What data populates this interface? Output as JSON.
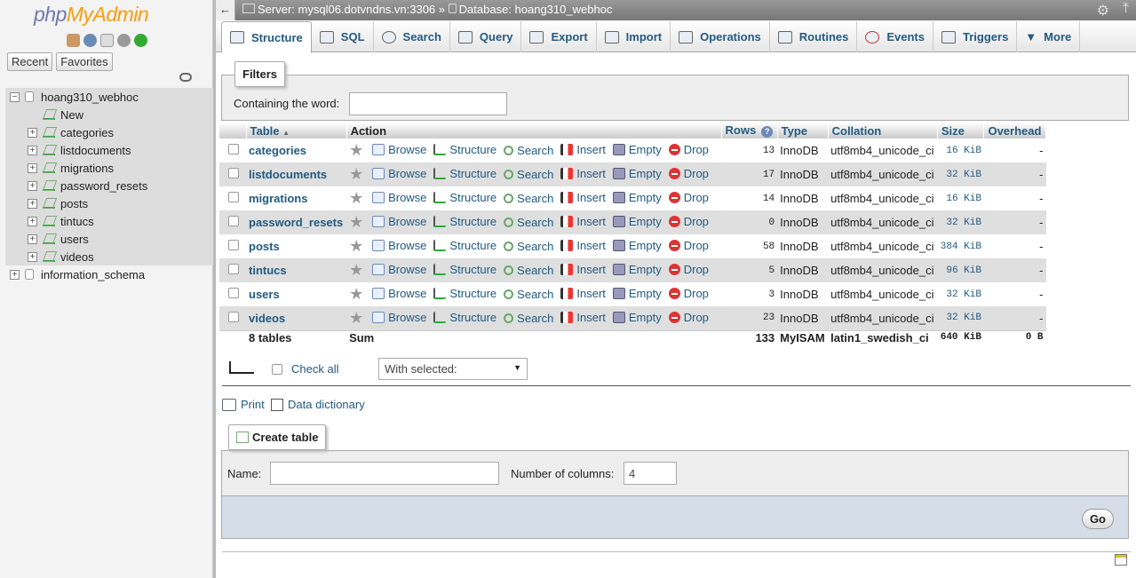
{
  "nav": {
    "logo_php": "php",
    "logo_myadmin": "MyAdmin",
    "icons": [
      "home-icon",
      "help-icon",
      "docs-icon",
      "settings-icon",
      "reload-icon"
    ],
    "recent_label": "Recent",
    "favorites_label": "Favorites",
    "tree": [
      {
        "label": "hoang310_webhoc",
        "kind": "db",
        "expanded": true
      },
      {
        "label": "New",
        "kind": "new"
      },
      {
        "label": "categories",
        "kind": "table"
      },
      {
        "label": "listdocuments",
        "kind": "table"
      },
      {
        "label": "migrations",
        "kind": "table"
      },
      {
        "label": "password_resets",
        "kind": "table"
      },
      {
        "label": "posts",
        "kind": "table"
      },
      {
        "label": "tintucs",
        "kind": "table"
      },
      {
        "label": "users",
        "kind": "table"
      },
      {
        "label": "videos",
        "kind": "table"
      },
      {
        "label": "information_schema",
        "kind": "db",
        "expanded": false
      }
    ]
  },
  "topbar": {
    "server": "Server: mysql06.dotvndns.vn:3306",
    "separator": "»",
    "database": "Database: hoang310_webhoc"
  },
  "tabs": [
    "Structure",
    "SQL",
    "Search",
    "Query",
    "Export",
    "Import",
    "Operations",
    "Routines",
    "Events",
    "Triggers",
    "More"
  ],
  "filters": {
    "legend": "Filters",
    "label": "Containing the word:",
    "value": ""
  },
  "table_headers": {
    "table": "Table",
    "action": "Action",
    "rows": "Rows",
    "type": "Type",
    "collation": "Collation",
    "size": "Size",
    "overhead": "Overhead"
  },
  "actions": {
    "browse": "Browse",
    "structure": "Structure",
    "search": "Search",
    "insert": "Insert",
    "empty": "Empty",
    "drop": "Drop"
  },
  "rows": [
    {
      "name": "categories",
      "rows": "13",
      "type": "InnoDB",
      "collation": "utf8mb4_unicode_ci",
      "size": "16 KiB",
      "overhead": "-"
    },
    {
      "name": "listdocuments",
      "rows": "17",
      "type": "InnoDB",
      "collation": "utf8mb4_unicode_ci",
      "size": "32 KiB",
      "overhead": "-"
    },
    {
      "name": "migrations",
      "rows": "14",
      "type": "InnoDB",
      "collation": "utf8mb4_unicode_ci",
      "size": "16 KiB",
      "overhead": "-"
    },
    {
      "name": "password_resets",
      "rows": "0",
      "type": "InnoDB",
      "collation": "utf8mb4_unicode_ci",
      "size": "32 KiB",
      "overhead": "-"
    },
    {
      "name": "posts",
      "rows": "58",
      "type": "InnoDB",
      "collation": "utf8mb4_unicode_ci",
      "size": "384 KiB",
      "overhead": "-"
    },
    {
      "name": "tintucs",
      "rows": "5",
      "type": "InnoDB",
      "collation": "utf8mb4_unicode_ci",
      "size": "96 KiB",
      "overhead": "-"
    },
    {
      "name": "users",
      "rows": "3",
      "type": "InnoDB",
      "collation": "utf8mb4_unicode_ci",
      "size": "32 KiB",
      "overhead": "-"
    },
    {
      "name": "videos",
      "rows": "23",
      "type": "InnoDB",
      "collation": "utf8mb4_unicode_ci",
      "size": "32 KiB",
      "overhead": "-"
    }
  ],
  "footer_row": {
    "tables": "8 tables",
    "sum": "Sum",
    "rows": "133",
    "type": "MyISAM",
    "collation": "latin1_swedish_ci",
    "size": "640 KiB",
    "overhead": "0 B"
  },
  "bulk": {
    "check_all": "Check all",
    "with_selected": "With selected:"
  },
  "links": {
    "print": "Print",
    "data_dictionary": "Data dictionary"
  },
  "create": {
    "legend": "Create table",
    "name_label": "Name:",
    "name_value": "",
    "columns_label": "Number of columns:",
    "columns_value": "4",
    "go_label": "Go"
  }
}
